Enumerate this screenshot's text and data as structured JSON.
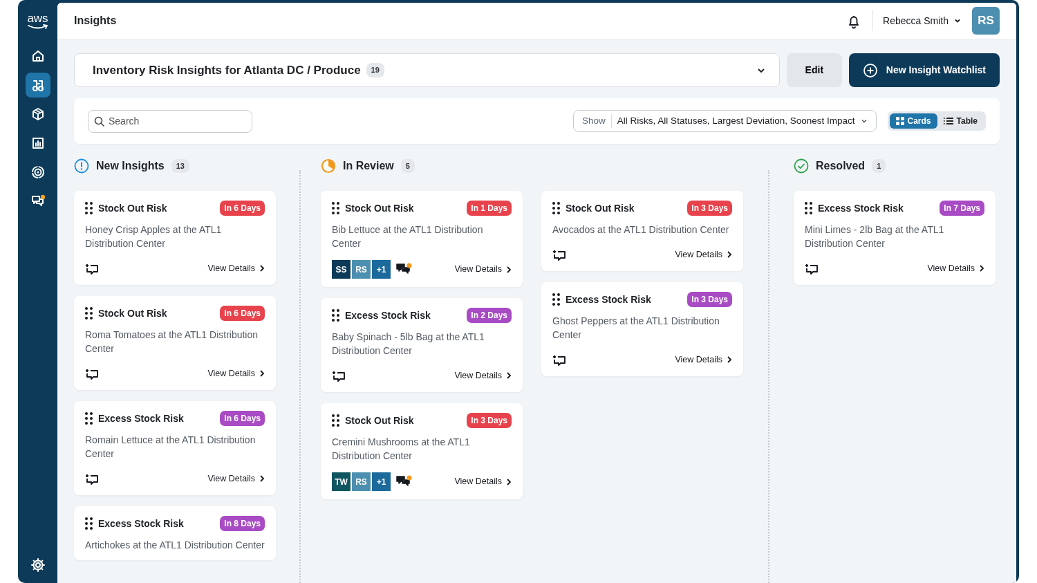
{
  "sidebar": {
    "logo": "aws",
    "items": [
      {
        "selected": false
      },
      {
        "selected": true
      },
      {
        "selected": false
      },
      {
        "selected": false
      },
      {
        "selected": false
      },
      {
        "selected": false
      }
    ]
  },
  "header": {
    "title": "Insights",
    "user": {
      "name": "Rebecca Smith",
      "initials": "RS"
    }
  },
  "watchlist": {
    "title": "Inventory Risk Insights for Atlanta DC / Produce",
    "count": "19",
    "edit": "Edit",
    "new": "New Insight Watchlist"
  },
  "filters": {
    "search": {
      "placeholder": "Search"
    },
    "show": {
      "label": "Show",
      "value": "All Risks, All Statuses, Largest Deviation, Soonest Impact"
    },
    "views": [
      {
        "label": "Cards",
        "selected": true
      },
      {
        "label": "Table",
        "selected": false
      }
    ]
  },
  "columns": [
    {
      "kind": "new",
      "title": "New Insights",
      "count": "13",
      "lanes": [
        [
          {
            "title": "Stock Out Risk",
            "badge": {
              "text": "In 6 Days",
              "color": "#e8434c"
            },
            "description": "Honey Crisp Apples at the ATL1 Distribution Center",
            "footer": {
              "kind": "add_comment"
            },
            "link": "View Details"
          },
          {
            "title": "Stock Out Risk",
            "badge": {
              "text": "In 6 Days",
              "color": "#e8434c"
            },
            "description": "Roma Tomatoes at the ATL1 Distribution Center",
            "footer": {
              "kind": "add_comment"
            },
            "link": "View Details"
          },
          {
            "title": "Excess Stock Risk",
            "badge": {
              "text": "In 6 Days",
              "color": "#a94bc4"
            },
            "description": "Romain Lettuce at the ATL1 Distribution Center",
            "footer": {
              "kind": "add_comment"
            },
            "link": "View Details"
          },
          {
            "title": "Excess Stock Risk",
            "badge": {
              "text": "In 8 Days",
              "color": "#a94bc4"
            },
            "description": "Artichokes at the ATL1 Distribution Center"
          }
        ]
      ]
    },
    {
      "kind": "review",
      "title": "In Review",
      "count": "5",
      "lanes": [
        [
          {
            "title": "Stock Out Risk",
            "badge": {
              "text": "In 1 Days",
              "color": "#e8434c"
            },
            "description": "Bib Lettuce at the ATL1 Distribution Center",
            "footer": {
              "kind": "discussion",
              "avatars": [
                {
                  "initials": "SS",
                  "color": "#0d3a58"
                },
                {
                  "initials": "RS",
                  "color": "#4d8fb0"
                },
                {
                  "initials": "+1",
                  "color": "#1c6a9c"
                }
              ]
            },
            "link": "View Details"
          },
          {
            "title": "Excess Stock Risk",
            "badge": {
              "text": "In 2 Days",
              "color": "#a94bc4"
            },
            "description": "Baby Spinach - 5lb Bag at the ATL1 Distribution Center",
            "footer": {
              "kind": "add_comment"
            },
            "link": "View Details"
          },
          {
            "title": "Stock Out Risk",
            "badge": {
              "text": "In 3 Days",
              "color": "#e8434c"
            },
            "description": "Cremini Mushrooms at the ATL1 Distribution Center",
            "footer": {
              "kind": "discussion",
              "avatars": [
                {
                  "initials": "TW",
                  "color": "#0f5660"
                },
                {
                  "initials": "RS",
                  "color": "#4d8fb0"
                },
                {
                  "initials": "+1",
                  "color": "#1c6a9c"
                }
              ]
            },
            "link": "View Details"
          }
        ],
        [
          {
            "title": "Stock Out Risk",
            "badge": {
              "text": "In 3 Days",
              "color": "#e8434c"
            },
            "description": "Avocados at the ATL1 Distribution Center",
            "footer": {
              "kind": "add_comment"
            },
            "link": "View Details"
          },
          {
            "title": "Excess Stock Risk",
            "badge": {
              "text": "In 3 Days",
              "color": "#a94bc4"
            },
            "description": "Ghost Peppers at the ATL1 Distribution Center",
            "footer": {
              "kind": "add_comment"
            },
            "link": "View Details"
          }
        ]
      ]
    },
    {
      "kind": "resolved",
      "title": "Resolved",
      "count": "1",
      "lanes": [
        [
          {
            "title": "Excess Stock Risk",
            "badge": {
              "text": "In 7 Days",
              "color": "#a94bc4"
            },
            "description": "Mini Limes - 2lb Bag at the ATL1 Distribution Center",
            "footer": {
              "kind": "add_comment"
            },
            "link": "View Details"
          }
        ]
      ]
    }
  ]
}
